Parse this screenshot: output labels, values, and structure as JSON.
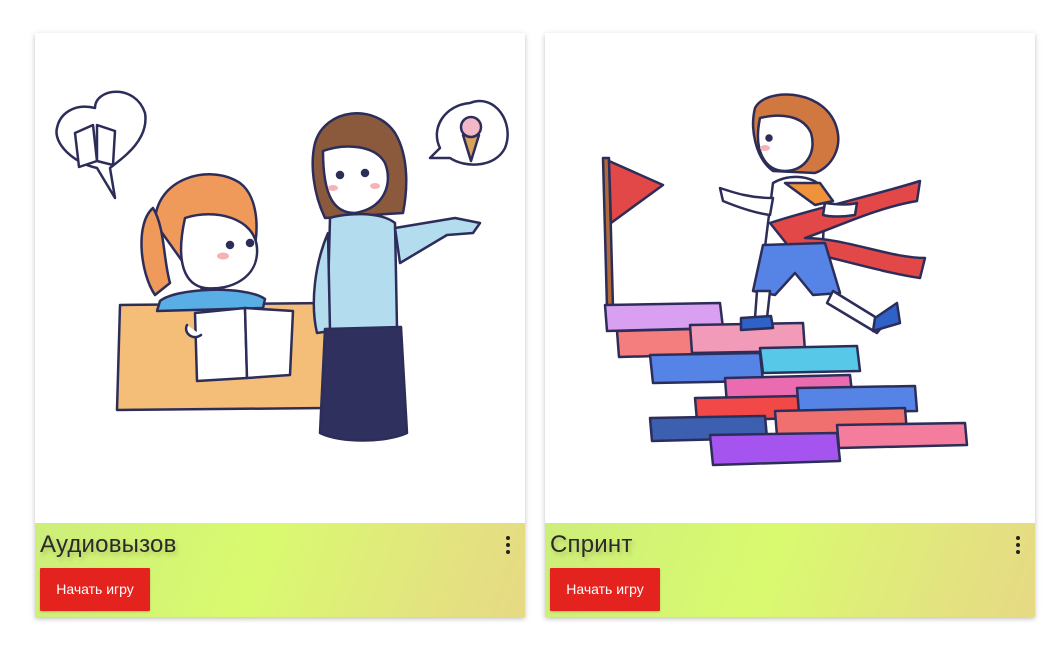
{
  "games": [
    {
      "title": "Аудиовызов",
      "button_label": "Начать игру",
      "illustration": "teacher-and-student"
    },
    {
      "title": "Спринт",
      "button_label": "Начать игру",
      "illustration": "boy-running-stairs-flag"
    }
  ],
  "colors": {
    "footer_gradient": [
      "#cdee7a",
      "#d9fa6f",
      "#e6d984"
    ],
    "button_bg": "#e4231f",
    "button_text": "#ffffff"
  }
}
